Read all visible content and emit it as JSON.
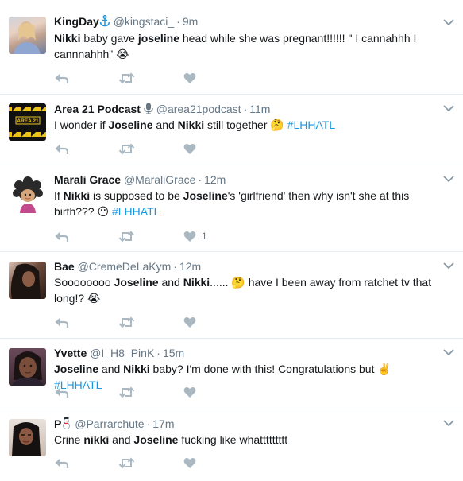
{
  "colors": {
    "text": "#14171a",
    "muted": "#657786",
    "link": "#1b95e0",
    "divider": "#e6ecf0",
    "icon": "#aab8c2"
  },
  "tweets": [
    {
      "name": "KingDay",
      "name_badge": "anchor",
      "handle": "@kingstaci_",
      "time": "9m",
      "parts": [
        {
          "b": "Nikki"
        },
        {
          "t": " baby gave "
        },
        {
          "b": "joseline"
        },
        {
          "t": " head while she was pregnant!!!!!! \" I cannahhh I cannnahhh\" "
        },
        {
          "emoji": "😭"
        }
      ],
      "likes": ""
    },
    {
      "name": "Area 21 Podcast",
      "name_badge": "microphone",
      "handle": "@area21podcast",
      "time": "11m",
      "parts": [
        {
          "t": "I wonder if "
        },
        {
          "b": "Joseline"
        },
        {
          "t": " and "
        },
        {
          "b": "Nikki"
        },
        {
          "t": " still together "
        },
        {
          "emoji": "🤔"
        },
        {
          "t": " "
        },
        {
          "tag": "#LHHATL"
        }
      ],
      "likes": ""
    },
    {
      "name": "Marali Grace",
      "name_badge": "",
      "handle": "@MaraliGrace",
      "time": "12m",
      "parts": [
        {
          "t": "If "
        },
        {
          "b": "Nikki"
        },
        {
          "t": " is supposed to be "
        },
        {
          "b": "Joseline"
        },
        {
          "t": "'s 'girlfriend' then why isn't she at this birth??? "
        },
        {
          "emoji": "😶"
        },
        {
          "t": " "
        },
        {
          "tag": "#LHHATL"
        }
      ],
      "likes": "1"
    },
    {
      "name": "Bae",
      "name_badge": "",
      "handle": "@CremeDeLaKym",
      "time": "12m",
      "parts": [
        {
          "t": "Soooooooo "
        },
        {
          "b": "Joseline"
        },
        {
          "t": " and "
        },
        {
          "b": "Nikki"
        },
        {
          "t": "...... "
        },
        {
          "emoji": "🤔"
        },
        {
          "t": " have I been away from ratchet tv that long!? "
        },
        {
          "emoji": "😭"
        }
      ],
      "likes": ""
    },
    {
      "name": "Yvette",
      "name_badge": "",
      "handle": "@I_H8_PinK",
      "time": "15m",
      "parts": [
        {
          "b": "Joseline"
        },
        {
          "t": " and "
        },
        {
          "b": "Nikki"
        },
        {
          "t": " baby? I'm done with this! Congratulations but "
        },
        {
          "emoji": "✌️"
        },
        {
          "t": " "
        },
        {
          "tag": "#LHHATL"
        }
      ],
      "likes": ""
    },
    {
      "name": "P",
      "name_badge": "snowman",
      "handle": "@Parrarchute",
      "time": "17m",
      "parts": [
        {
          "t": "Crine "
        },
        {
          "b": "nikki"
        },
        {
          "t": " and "
        },
        {
          "b": "Joseline"
        },
        {
          "t": " fucking like whattttttttt"
        }
      ],
      "likes": ""
    }
  ]
}
